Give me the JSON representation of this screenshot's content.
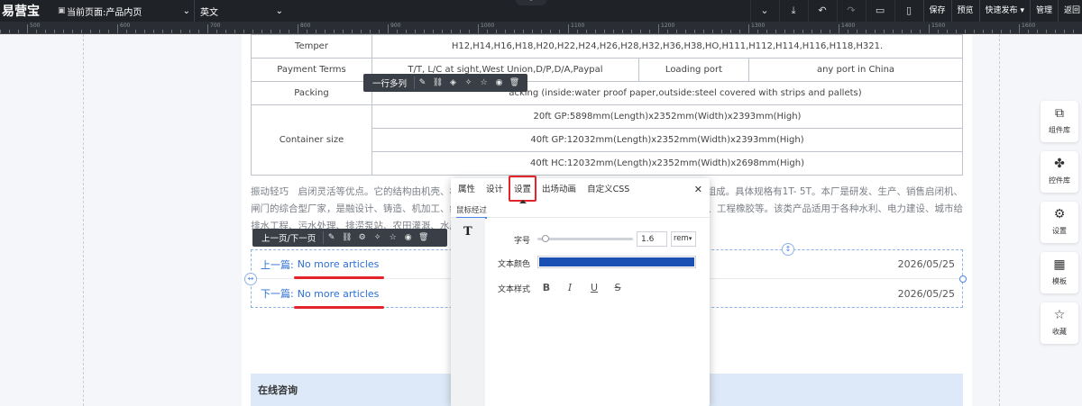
{
  "topbar": {
    "logo": "易营宝",
    "current_page": "当前页面:产品内页",
    "language": "英文",
    "buttons": [
      "保存",
      "预览",
      "快速发布",
      "管理",
      "返回"
    ]
  },
  "ruler": {
    "labels": [
      "500",
      "600",
      "700",
      "800",
      "900",
      "1000",
      "1100",
      "1200",
      "1300",
      "1400",
      "1500",
      "1600"
    ]
  },
  "spec_table": {
    "temper_label": "Temper",
    "temper_value": "H12,H14,H16,H18,H20,H22,H24,H26,H28,H32,H36,H38,HO,H111,H112,H114,H116,H118,H321.",
    "payment_label": "Payment Terms",
    "payment_value": "T/T, L/C at sight,West Union,D/P,D/A,Paypal",
    "loading_label": "Loading port",
    "loading_value": "any port in China",
    "packing_label": "Packing",
    "packing_value": "acking (inside:water proof paper,outside:steel covered with strips and pallets)",
    "container_label": "Container size",
    "container_values": [
      "20ft GP:5898mm(Length)x2352mm(Width)x2393mm(High)",
      "40ft GP:12032mm(Length)x2352mm(Width)x2393mm(High)",
      "40ft HC:12032mm(Length)x2352mm(Width)x2698mm(High)"
    ]
  },
  "description": {
    "line1_left": "振动轻巧　启闭灵活等优点。它的结构由机壳、机",
    "line1_right": "组成。具体规格有1T- 5T。本厂是研发、生产、销售启闭机、",
    "line2_left": "闸门的综合型厂家，是融设计、铸造、机加工、组",
    "line2_right": "、工程橡胶等。该类产品适用于各种水利、电力建设、城市给",
    "line3_left": "排水工程、污水处理、排涝泵站、农田灌溉、水产"
  },
  "row_toolbar": {
    "name": "一行多列"
  },
  "pn_toolbar": {
    "name": "上一页/下一页"
  },
  "prev_next": {
    "prev_label": "上一篇:",
    "prev_link": "No more articles",
    "prev_date": "2026/05/25",
    "next_label": "下一篇:",
    "next_link": "No more articles",
    "next_date": "2026/05/25"
  },
  "consult": {
    "title": "在线咨询"
  },
  "side_panel": {
    "items": [
      {
        "label": "组件库",
        "icon": "copy-icon"
      },
      {
        "label": "控件库",
        "icon": "puzzle-icon"
      },
      {
        "label": "设置",
        "icon": "gear-icon"
      },
      {
        "label": "模板",
        "icon": "layout-icon"
      },
      {
        "label": "收藏",
        "icon": "star-icon"
      }
    ]
  },
  "settings_popup": {
    "tabs": [
      "属性",
      "设计",
      "设置",
      "出场动画",
      "自定义CSS"
    ],
    "active_tab": "设置",
    "sub_tab": "鼠标经过",
    "font_size_label": "字号",
    "font_size_value": "1.6",
    "font_size_unit": "rem",
    "font_size_fraction": 0.05,
    "text_color_label": "文本颜色",
    "text_color": "#1a4fb3",
    "text_style_label": "文本样式",
    "style_buttons": [
      "B",
      "I",
      "U",
      "S"
    ]
  }
}
